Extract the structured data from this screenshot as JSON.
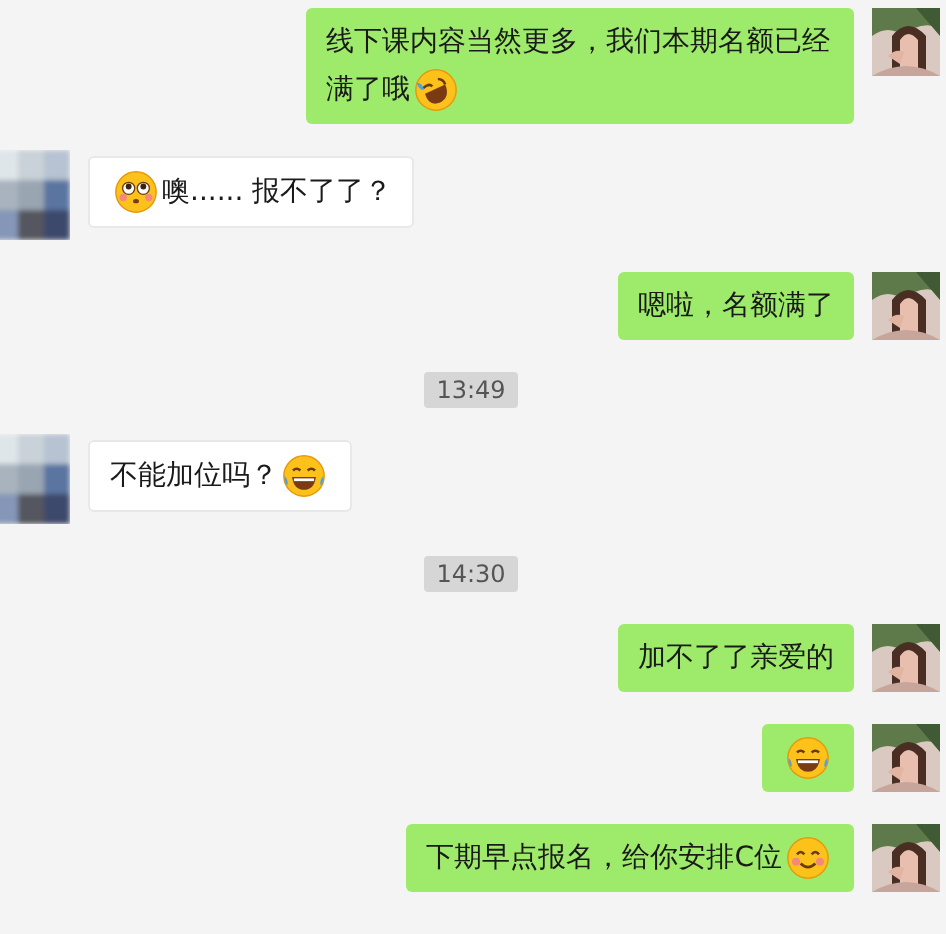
{
  "messages": [
    {
      "kind": "sent",
      "parts": [
        {
          "kind": "text",
          "text": "线下课内容当然更多，我们本期名额已经"
        },
        {
          "kind": "text",
          "text": "满了哦"
        },
        {
          "kind": "laughing"
        }
      ]
    },
    {
      "kind": "received",
      "parts": [
        {
          "kind": "pleading"
        },
        {
          "kind": "text",
          "text": "噢...... 报不了了？"
        }
      ]
    },
    {
      "kind": "sent",
      "parts": [
        {
          "kind": "text",
          "text": "嗯啦，名额满了"
        }
      ]
    },
    {
      "kind": "time",
      "text": "13:49"
    },
    {
      "kind": "received",
      "parts": [
        {
          "kind": "text",
          "text": "不能加位吗？"
        },
        {
          "kind": "joy"
        }
      ]
    },
    {
      "kind": "time",
      "text": "14:30"
    },
    {
      "kind": "sent",
      "parts": [
        {
          "kind": "text",
          "text": "加不了了亲爱的"
        }
      ]
    },
    {
      "kind": "sent",
      "parts": [
        {
          "kind": "joy"
        }
      ]
    },
    {
      "kind": "sent",
      "parts": [
        {
          "kind": "text",
          "text": "下期早点报名，给你安排C位"
        },
        {
          "kind": "smile"
        }
      ]
    }
  ]
}
